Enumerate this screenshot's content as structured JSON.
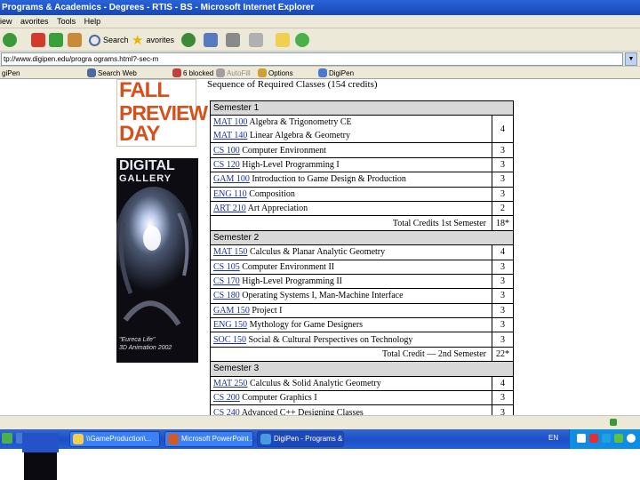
{
  "window": {
    "title": "Programs & Academics - Degrees - RTIS - BS - Microsoft Internet Explorer"
  },
  "menu": [
    "iew",
    "avorites",
    "Tools",
    "Help"
  ],
  "toolbar": {
    "search_label": "Search",
    "favorites_label": "avorites"
  },
  "address": {
    "url": "tp://www.digipen.edu/progra   ograms.html?-sec-m"
  },
  "links_bar": {
    "label": "giPen",
    "search_web": "Search Web",
    "blocked": "6 blocked",
    "autofill": "AutoFill",
    "options": "Options",
    "digipen": "DigiPen"
  },
  "banner": {
    "line1": "FALL",
    "line2": "PREVIEW",
    "line3": "DAY"
  },
  "gallery": {
    "title": "DIGITAL",
    "subtitle": "GALLERY",
    "caption1": "\"Eureca Life\"",
    "caption2": "3D Animation 2002"
  },
  "sequence_title": "Sequence of Required Classes (154 credits)",
  "semesters": [
    {
      "name": "Semester 1",
      "rows": [
        {
          "code": "MAT 100",
          "title": "Algebra & Trigonometry CE",
          "credits": ""
        },
        {
          "code": "MAT 140",
          "title": "Linear Algebra & Geometry",
          "credits": "4"
        },
        {
          "code": "CS 100",
          "title": "Computer Environment",
          "credits": "3"
        },
        {
          "code": "CS 120",
          "title": "High-Level Programming I",
          "credits": "3"
        },
        {
          "code": "GAM 100",
          "title": "Introduction to Game Design & Production",
          "credits": "3"
        },
        {
          "code": "ENG 110",
          "title": "Composition",
          "credits": "3"
        },
        {
          "code": "ART 210",
          "title": "Art Appreciation",
          "credits": "2"
        }
      ],
      "total_label": "Total Credits       1st Semester",
      "total_value": "18*"
    },
    {
      "name": "Semester 2",
      "rows": [
        {
          "code": "MAT 150",
          "title": "Calculus & Planar Analytic Geometry",
          "credits": "4"
        },
        {
          "code": "CS 105",
          "title": "Computer Environment II",
          "credits": "3"
        },
        {
          "code": "CS 170",
          "title": "High-Level Programming II",
          "credits": "3"
        },
        {
          "code": "CS 180",
          "title": "Operating Systems I, Man-Machine Interface",
          "credits": "3"
        },
        {
          "code": "GAM 150",
          "title": "Project I",
          "credits": "3"
        },
        {
          "code": "ENG 150",
          "title": "Mythology for Game Designers",
          "credits": "3"
        },
        {
          "code": "SOC 150",
          "title": "Social & Cultural Perspectives on Technology",
          "credits": "3"
        }
      ],
      "total_label": "Total Credit  — 2nd Semester",
      "total_value": "22*"
    },
    {
      "name": "Semester 3",
      "rows": [
        {
          "code": "MAT 250",
          "title": "Calculus & Solid Analytic Geometry",
          "credits": "4"
        },
        {
          "code": "CS 200",
          "title": "Computer Graphics I",
          "credits": "3"
        },
        {
          "code": "CS 240",
          "title": "Advanced C++ Designing Classes",
          "credits": "3"
        }
      ]
    }
  ],
  "taskbar": {
    "items": [
      {
        "label": "\\\\GameProduction\\..."
      },
      {
        "label": "Microsoft PowerPoint ..."
      },
      {
        "label": "DigiPen - Programs & ..."
      }
    ],
    "language": "EN"
  },
  "colors": {
    "titlebar": "#1547b8",
    "link": "#1a2fa8",
    "banner_orange": "#d6501c",
    "taskbar": "#245edb"
  }
}
